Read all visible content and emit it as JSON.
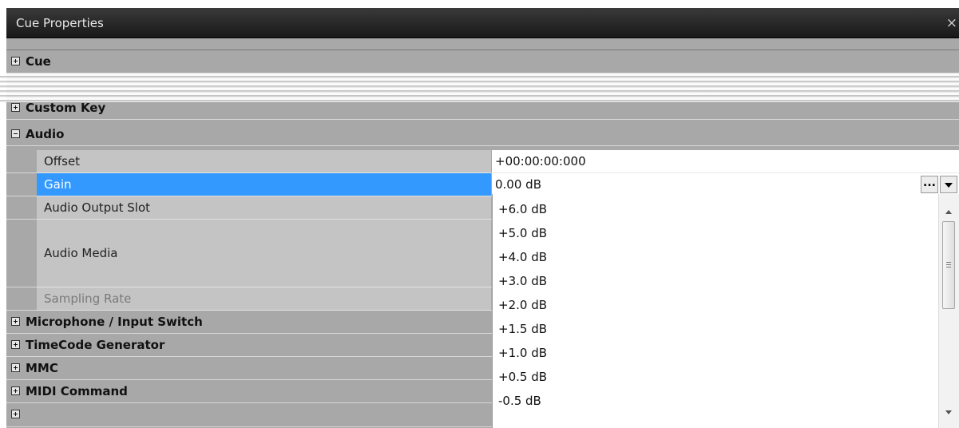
{
  "window": {
    "title": "Cue Properties",
    "close_glyph": "×"
  },
  "categories_top": [
    {
      "label": "Cue",
      "expanded": false
    },
    {
      "label": "Custom Key",
      "expanded": false
    },
    {
      "label": "Audio",
      "expanded": true
    }
  ],
  "audio_properties": {
    "offset": {
      "name": "Offset",
      "value": "+00:00:00:000"
    },
    "gain": {
      "name": "Gain",
      "value": "0.00 dB"
    },
    "output_slot": {
      "name": "Audio Output Slot"
    },
    "media": {
      "name": "Audio Media"
    },
    "sampling_rate": {
      "name": "Sampling Rate"
    }
  },
  "categories_bottom": [
    {
      "label": "Microphone / Input Switch",
      "expanded": false
    },
    {
      "label": "TimeCode Generator",
      "expanded": false
    },
    {
      "label": "MMC",
      "expanded": false
    },
    {
      "label": "MIDI Command",
      "expanded": false
    }
  ],
  "gain_dropdown": {
    "ellipsis_label": "...",
    "options": [
      "+6.0 dB",
      "+5.0 dB",
      "+4.0 dB",
      "+3.0 dB",
      "+2.0 dB",
      "+1.5 dB",
      "+1.0 dB",
      "+0.5 dB",
      "-0.5 dB"
    ]
  },
  "colors": {
    "selection": "#3399ff",
    "title_bar": "#1e1e1e",
    "grid_background": "#a8a8a8",
    "property_name_background": "#c4c4c4"
  }
}
